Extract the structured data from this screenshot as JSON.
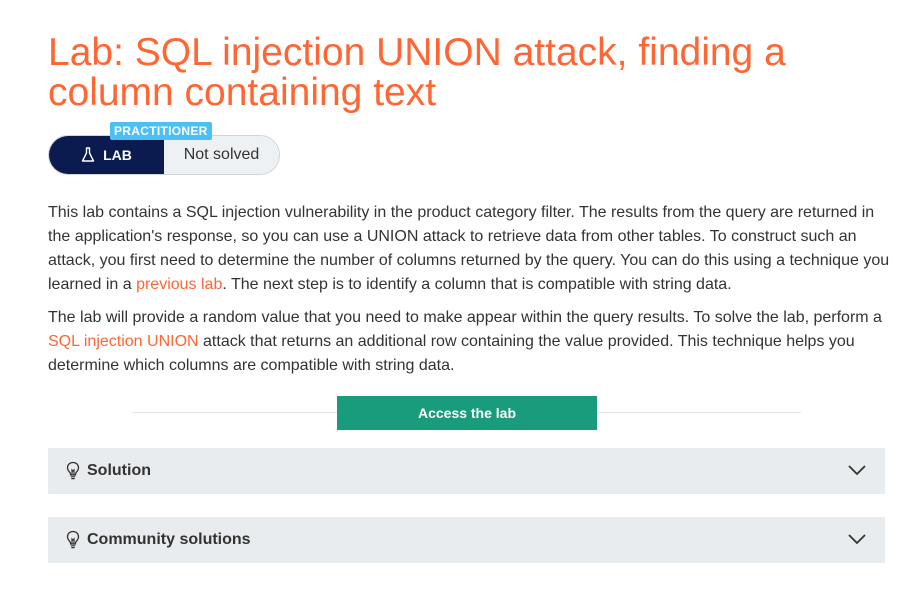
{
  "header": {
    "title": "Lab: SQL injection UNION attack, finding a column containing text"
  },
  "badge": {
    "level": "PRACTITIONER",
    "lab_label": "LAB",
    "status": "Not solved"
  },
  "description": {
    "p1_before_link": "This lab contains a SQL injection vulnerability in the product category filter. The results from the query are returned in the application's response, so you can use a UNION attack to retrieve data from other tables. To construct such an attack, you first need to determine the number of columns returned by the query. You can do this using a technique you learned in a ",
    "p1_link": "previous lab",
    "p1_after_link": ". The next step is to identify a column that is compatible with string data.",
    "p2_before_link": "The lab will provide a random value that you need to make appear within the query results. To solve the lab, perform a ",
    "p2_link": "SQL injection UNION",
    "p2_after_link": " attack that returns an additional row containing the value provided. This technique helps you determine which columns are compatible with string data."
  },
  "actions": {
    "access_lab": "Access the lab"
  },
  "accordions": [
    {
      "label": "Solution",
      "icon": "lightbulb-icon"
    },
    {
      "label": "Community solutions",
      "icon": "lightbulb-icon"
    }
  ],
  "colors": {
    "accent": "#ff6633",
    "lab_badge_bg": "#0b1a4f",
    "level_badge_bg": "#4cc0f4",
    "access_button_bg": "#199c7c",
    "accordion_bg": "#e8ecef"
  }
}
